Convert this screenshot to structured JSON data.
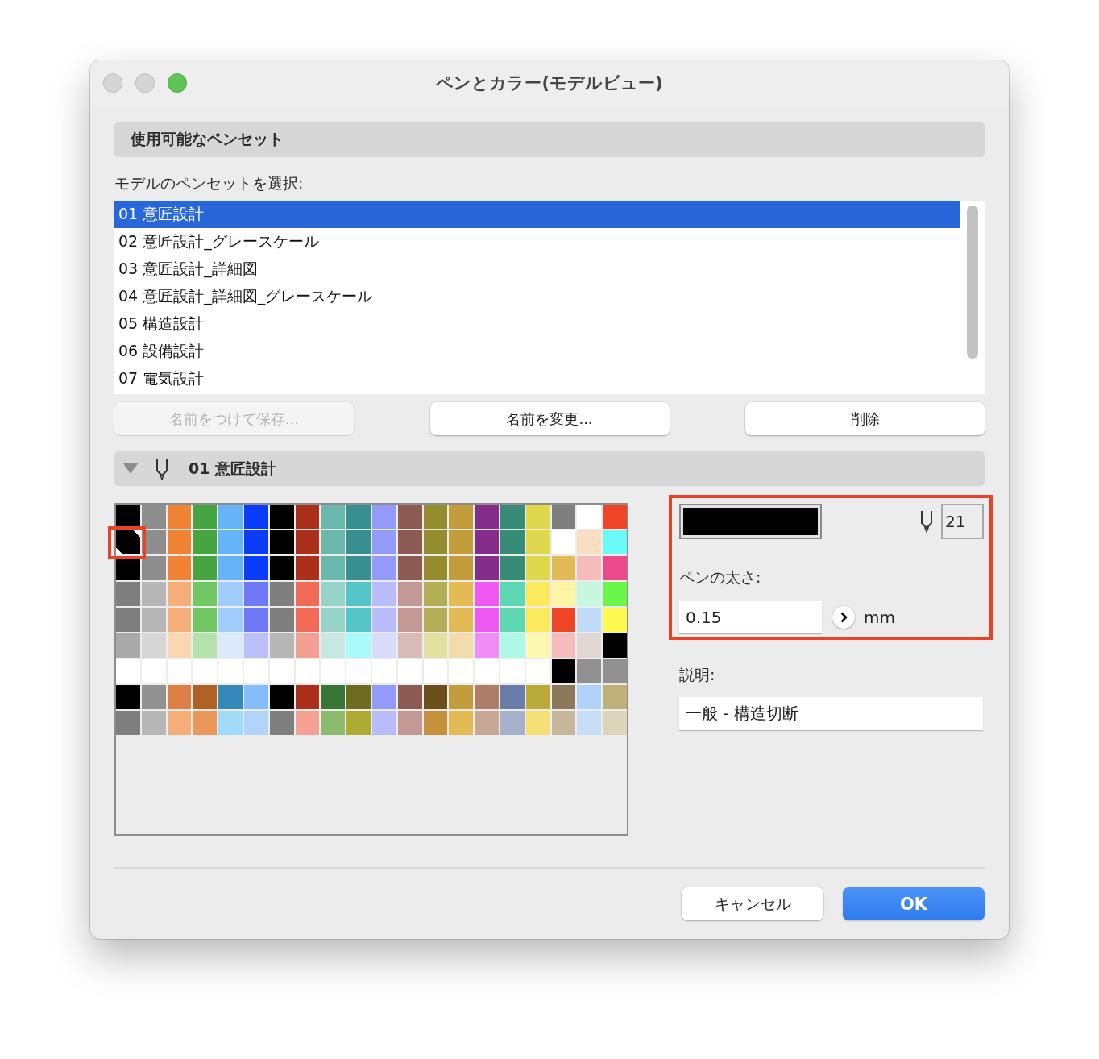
{
  "window": {
    "title": "ペンとカラー(モデルビュー)",
    "controls": [
      {
        "kind": "close",
        "disabled": true
      },
      {
        "kind": "minimize",
        "disabled": true
      },
      {
        "kind": "zoom",
        "disabled": false
      }
    ]
  },
  "pen_sets": {
    "header": "使用可能なペンセット",
    "label": "モデルのペンセットを選択:",
    "items": [
      {
        "label": "01 意匠設計",
        "selected": true
      },
      {
        "label": "02 意匠設計_グレースケール",
        "selected": false
      },
      {
        "label": "03 意匠設計_詳細図",
        "selected": false
      },
      {
        "label": "04 意匠設計_詳細図_グレースケール",
        "selected": false
      },
      {
        "label": "05 構造設計",
        "selected": false
      },
      {
        "label": "06 設備設計",
        "selected": false
      },
      {
        "label": "07 電気設計",
        "selected": false
      }
    ],
    "buttons": [
      {
        "label": "名前をつけて保存...",
        "disabled": true
      },
      {
        "label": "名前を変更...",
        "disabled": false
      },
      {
        "label": "削除",
        "disabled": false
      }
    ]
  },
  "palette_section": {
    "title": "01 意匠設計",
    "expanded": true
  },
  "palette": {
    "rows": [
      [
        {
          "color": "#000000",
          "selected": false
        },
        {
          "color": "#8e8e8e",
          "selected": false
        },
        {
          "color": "#f08434",
          "selected": false
        },
        {
          "color": "#44a541",
          "selected": false
        },
        {
          "color": "#66b4f8",
          "selected": false
        },
        {
          "color": "#0a3cfa",
          "selected": false
        },
        {
          "color": "#000000",
          "selected": false
        },
        {
          "color": "#aa301c",
          "selected": false
        },
        {
          "color": "#6ab8ac",
          "selected": false
        },
        {
          "color": "#378f8f",
          "selected": false
        },
        {
          "color": "#939bfa",
          "selected": false
        },
        {
          "color": "#8c5a53",
          "selected": false
        },
        {
          "color": "#938d2e",
          "selected": false
        },
        {
          "color": "#c39c3c",
          "selected": false
        },
        {
          "color": "#862d8c",
          "selected": false
        },
        {
          "color": "#378c77",
          "selected": false
        },
        {
          "color": "#e0d84c",
          "selected": false
        },
        {
          "color": "#7f7f7f",
          "selected": false
        },
        {
          "color": "#ffffff",
          "selected": false
        },
        {
          "color": "#ef4526",
          "selected": false
        }
      ],
      [
        {
          "color": "#000000",
          "selected": true
        },
        {
          "color": "#8e8e8e",
          "selected": false
        },
        {
          "color": "#f08434",
          "selected": false
        },
        {
          "color": "#44a541",
          "selected": false
        },
        {
          "color": "#66b4f8",
          "selected": false
        },
        {
          "color": "#0a3cfa",
          "selected": false
        },
        {
          "color": "#000000",
          "selected": false
        },
        {
          "color": "#aa301c",
          "selected": false
        },
        {
          "color": "#6ab8ac",
          "selected": false
        },
        {
          "color": "#378f8f",
          "selected": false
        },
        {
          "color": "#939bfa",
          "selected": false
        },
        {
          "color": "#8c5a53",
          "selected": false
        },
        {
          "color": "#938d2e",
          "selected": false
        },
        {
          "color": "#c39c3c",
          "selected": false
        },
        {
          "color": "#862d8c",
          "selected": false
        },
        {
          "color": "#378c77",
          "selected": false
        },
        {
          "color": "#e0d84c",
          "selected": false
        },
        {
          "color": "#ffffff",
          "selected": false
        },
        {
          "color": "#fadec2",
          "selected": false
        },
        {
          "color": "#6cf9f9",
          "selected": false
        }
      ],
      [
        {
          "color": "#000000",
          "selected": false
        },
        {
          "color": "#8e8e8e",
          "selected": false
        },
        {
          "color": "#f08434",
          "selected": false
        },
        {
          "color": "#44a541",
          "selected": false
        },
        {
          "color": "#66b4f8",
          "selected": false
        },
        {
          "color": "#0a3cfa",
          "selected": false
        },
        {
          "color": "#000000",
          "selected": false
        },
        {
          "color": "#aa301c",
          "selected": false
        },
        {
          "color": "#6ab8ac",
          "selected": false
        },
        {
          "color": "#378f8f",
          "selected": false
        },
        {
          "color": "#939bfa",
          "selected": false
        },
        {
          "color": "#8c5a53",
          "selected": false
        },
        {
          "color": "#938d2e",
          "selected": false
        },
        {
          "color": "#c39c3c",
          "selected": false
        },
        {
          "color": "#862d8c",
          "selected": false
        },
        {
          "color": "#378c77",
          "selected": false
        },
        {
          "color": "#e0d84c",
          "selected": false
        },
        {
          "color": "#e2bb55",
          "selected": false
        },
        {
          "color": "#f6bcbc",
          "selected": false
        },
        {
          "color": "#ed4a8e",
          "selected": false
        }
      ],
      [
        {
          "color": "#7f7f7f",
          "selected": false
        },
        {
          "color": "#b7b7b7",
          "selected": false
        },
        {
          "color": "#f5ae78",
          "selected": false
        },
        {
          "color": "#70c764",
          "selected": false
        },
        {
          "color": "#a0cdfb",
          "selected": false
        },
        {
          "color": "#6e78f8",
          "selected": false
        },
        {
          "color": "#7f7f7f",
          "selected": false
        },
        {
          "color": "#f06a55",
          "selected": false
        },
        {
          "color": "#96d3c9",
          "selected": false
        },
        {
          "color": "#53c5c7",
          "selected": false
        },
        {
          "color": "#b9bcfa",
          "selected": false
        },
        {
          "color": "#c49894",
          "selected": false
        },
        {
          "color": "#b3ae55",
          "selected": false
        },
        {
          "color": "#e2bb55",
          "selected": false
        },
        {
          "color": "#ef58f3",
          "selected": false
        },
        {
          "color": "#5dd6b2",
          "selected": false
        },
        {
          "color": "#fcea5e",
          "selected": false
        },
        {
          "color": "#fdf4a4",
          "selected": false
        },
        {
          "color": "#c6f8e0",
          "selected": false
        },
        {
          "color": "#6af74a",
          "selected": false
        }
      ],
      [
        {
          "color": "#7f7f7f",
          "selected": false
        },
        {
          "color": "#b7b7b7",
          "selected": false
        },
        {
          "color": "#f5ae78",
          "selected": false
        },
        {
          "color": "#70c764",
          "selected": false
        },
        {
          "color": "#a0cdfb",
          "selected": false
        },
        {
          "color": "#6e78f8",
          "selected": false
        },
        {
          "color": "#7f7f7f",
          "selected": false
        },
        {
          "color": "#f06a55",
          "selected": false
        },
        {
          "color": "#96d3c9",
          "selected": false
        },
        {
          "color": "#53c5c7",
          "selected": false
        },
        {
          "color": "#b9bcfa",
          "selected": false
        },
        {
          "color": "#c49894",
          "selected": false
        },
        {
          "color": "#b3ae55",
          "selected": false
        },
        {
          "color": "#e2bb55",
          "selected": false
        },
        {
          "color": "#ef58f3",
          "selected": false
        },
        {
          "color": "#5dd6b2",
          "selected": false
        },
        {
          "color": "#fcea5e",
          "selected": false
        },
        {
          "color": "#ef4526",
          "selected": false
        },
        {
          "color": "#c0dcf8",
          "selected": false
        },
        {
          "color": "#fdfb52",
          "selected": false
        }
      ],
      [
        {
          "color": "#a9a9a9",
          "selected": false
        },
        {
          "color": "#d6d6d6",
          "selected": false
        },
        {
          "color": "#f8d7b1",
          "selected": false
        },
        {
          "color": "#b3e2aa",
          "selected": false
        },
        {
          "color": "#dbe9fb",
          "selected": false
        },
        {
          "color": "#bac0fa",
          "selected": false
        },
        {
          "color": "#b7b7b7",
          "selected": false
        },
        {
          "color": "#f3a092",
          "selected": false
        },
        {
          "color": "#c8e6e2",
          "selected": false
        },
        {
          "color": "#aafafb",
          "selected": false
        },
        {
          "color": "#d9dbfb",
          "selected": false
        },
        {
          "color": "#d9bbb8",
          "selected": false
        },
        {
          "color": "#e3e1a2",
          "selected": false
        },
        {
          "color": "#f1dcac",
          "selected": false
        },
        {
          "color": "#f08df7",
          "selected": false
        },
        {
          "color": "#adf9e6",
          "selected": false
        },
        {
          "color": "#fef7af",
          "selected": false
        },
        {
          "color": "#f6bcbc",
          "selected": false
        },
        {
          "color": "#e1d8d5",
          "selected": false
        },
        {
          "color": "#000000",
          "selected": false
        }
      ],
      [
        {
          "color": "#ffffff",
          "selected": false
        },
        {
          "color": "#ffffff",
          "selected": false
        },
        {
          "color": "#ffffff",
          "selected": false
        },
        {
          "color": "#ffffff",
          "selected": false
        },
        {
          "color": "#ffffff",
          "selected": false
        },
        {
          "color": "#ffffff",
          "selected": false
        },
        {
          "color": "#ffffff",
          "selected": false
        },
        {
          "color": "#ffffff",
          "selected": false
        },
        {
          "color": "#ffffff",
          "selected": false
        },
        {
          "color": "#ffffff",
          "selected": false
        },
        {
          "color": "#ffffff",
          "selected": false
        },
        {
          "color": "#ffffff",
          "selected": false
        },
        {
          "color": "#ffffff",
          "selected": false
        },
        {
          "color": "#ffffff",
          "selected": false
        },
        {
          "color": "#ffffff",
          "selected": false
        },
        {
          "color": "#ffffff",
          "selected": false
        },
        {
          "color": "#ffffff",
          "selected": false
        },
        {
          "color": "#000000",
          "selected": false
        },
        {
          "color": "#919191",
          "selected": false
        },
        {
          "color": "#919191",
          "selected": false
        }
      ],
      [
        {
          "color": "#000000",
          "selected": false
        },
        {
          "color": "#919191",
          "selected": false
        },
        {
          "color": "#de7f47",
          "selected": false
        },
        {
          "color": "#b06126",
          "selected": false
        },
        {
          "color": "#3589b9",
          "selected": false
        },
        {
          "color": "#83bdfa",
          "selected": false
        },
        {
          "color": "#000000",
          "selected": false
        },
        {
          "color": "#aa301c",
          "selected": false
        },
        {
          "color": "#377637",
          "selected": false
        },
        {
          "color": "#6f6c22",
          "selected": false
        },
        {
          "color": "#939bfa",
          "selected": false
        },
        {
          "color": "#8c5a53",
          "selected": false
        },
        {
          "color": "#6b501c",
          "selected": false
        },
        {
          "color": "#c39c3c",
          "selected": false
        },
        {
          "color": "#af7e69",
          "selected": false
        },
        {
          "color": "#6a7ca8",
          "selected": false
        },
        {
          "color": "#baa93b",
          "selected": false
        },
        {
          "color": "#8b795b",
          "selected": false
        },
        {
          "color": "#b0d2f8",
          "selected": false
        },
        {
          "color": "#c0b17b",
          "selected": false
        }
      ],
      [
        {
          "color": "#7f7f7f",
          "selected": false
        },
        {
          "color": "#b7b7b7",
          "selected": false
        },
        {
          "color": "#f5ae78",
          "selected": false
        },
        {
          "color": "#ea9758",
          "selected": false
        },
        {
          "color": "#a1dbfa",
          "selected": false
        },
        {
          "color": "#b1d4f8",
          "selected": false
        },
        {
          "color": "#7f7f7f",
          "selected": false
        },
        {
          "color": "#f4a093",
          "selected": false
        },
        {
          "color": "#8abb6f",
          "selected": false
        },
        {
          "color": "#aeab35",
          "selected": false
        },
        {
          "color": "#b9bcfa",
          "selected": false
        },
        {
          "color": "#c49894",
          "selected": false
        },
        {
          "color": "#c4903a",
          "selected": false
        },
        {
          "color": "#e2bb55",
          "selected": false
        },
        {
          "color": "#c6a793",
          "selected": false
        },
        {
          "color": "#a6b1cc",
          "selected": false
        },
        {
          "color": "#f4e074",
          "selected": false
        },
        {
          "color": "#c6b69d",
          "selected": false
        },
        {
          "color": "#c9ddf8",
          "selected": false
        },
        {
          "color": "#ddd6bc",
          "selected": false
        }
      ]
    ]
  },
  "pen": {
    "color": "#000000",
    "number": "21",
    "thickness_label": "ペンの太さ:",
    "thickness": "0.15",
    "unit": "mm",
    "description_label": "説明:",
    "description": "一般 - 構造切断"
  },
  "buttons": [
    {
      "label": "キャンセル",
      "kind": "secondary"
    },
    {
      "label": "OK",
      "kind": "primary"
    }
  ]
}
